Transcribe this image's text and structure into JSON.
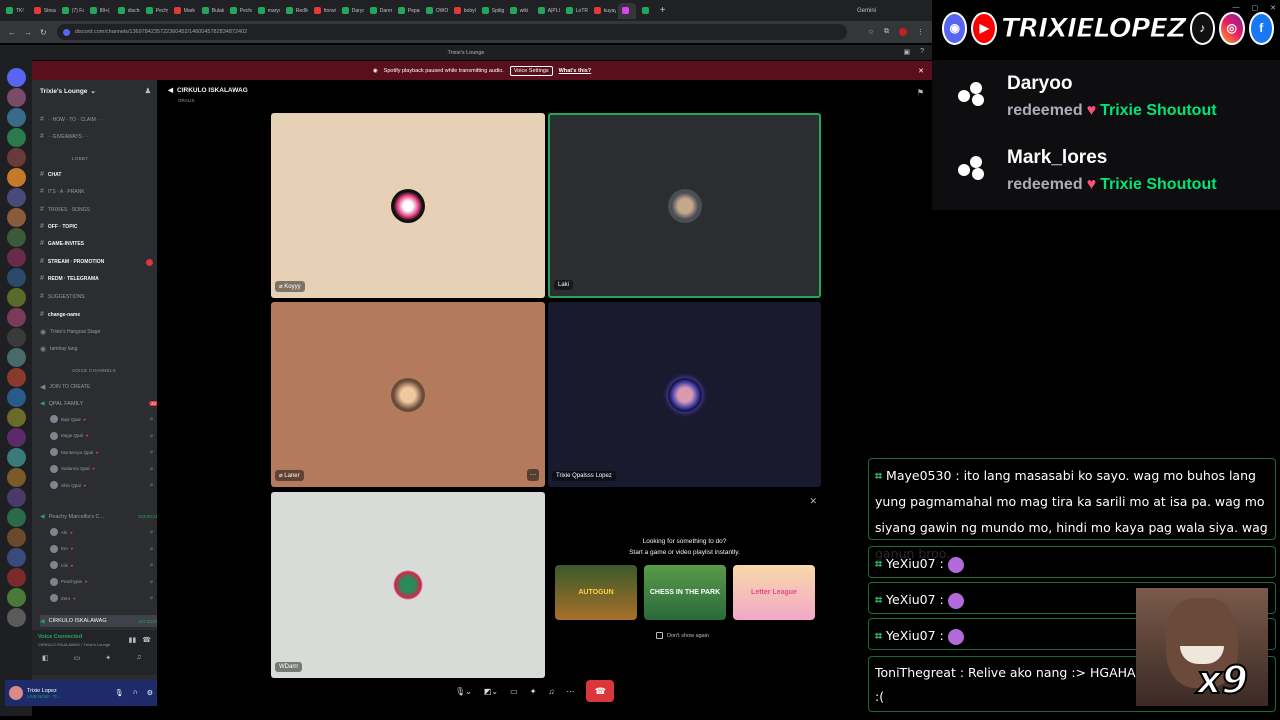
{
  "browser": {
    "tabs": [
      "TK!",
      "Strea",
      "(7) Fa",
      "89+|",
      "discho",
      "Pechy",
      "Mark",
      "Bulak",
      "Pecha",
      "marys",
      "RedM",
      "Itorwi",
      "Daryo",
      "Daren",
      "Pepan",
      "OWO",
      "bobyl",
      "Spitig",
      "wiki",
      "A|PLI",
      "LoTR",
      "kuyay",
      "",
      ""
    ],
    "gemini_label": "Gemini",
    "url": "discord.com/channels/1369784235722360452/1460045782834872402"
  },
  "discord": {
    "window_title": "Trixie's Lounge",
    "notice": {
      "text": "Spotify playback paused while transmitting audio.",
      "button": "Voice Settings",
      "link": "What's this?"
    },
    "server_name": "Trixie's Lounge",
    "channels": [
      {
        "name": "· ·HOW · TO · CLAIM · ·",
        "type": "text"
      },
      {
        "name": "· ·GIVEAWAYS · ·",
        "type": "text"
      },
      {
        "name": "LOBBY",
        "type": "category"
      },
      {
        "name": "CHAT",
        "type": "text"
      },
      {
        "name": "ITS · A · PRANK",
        "type": "text"
      },
      {
        "name": "TRIXIES · SONGS",
        "type": "text"
      },
      {
        "name": "OFF · TOPIC",
        "type": "text"
      },
      {
        "name": "GAME-INVITES",
        "type": "text"
      },
      {
        "name": "STREAM · PROMOTION",
        "type": "text"
      },
      {
        "name": "REDM · TELEGRAMA",
        "type": "text"
      },
      {
        "name": "SUGGESTIONS",
        "type": "text"
      },
      {
        "name": "change-name",
        "type": "text"
      },
      {
        "name": "Trixie's Hangout Stage",
        "type": "stage"
      },
      {
        "name": "tambay lang",
        "type": "stage"
      },
      {
        "name": "VOICE CHANNELS",
        "type": "category"
      },
      {
        "name": "JOIN TO CREATE",
        "type": "voice"
      }
    ],
    "voice_channels": [
      {
        "name": "QPAL FAMILY",
        "count": "22",
        "users": [
          "Bajs Qpal",
          "Mage Qpal",
          "Monteroyo Qpal",
          "Satianna Qpal",
          "Shin Qpal"
        ]
      },
      {
        "name": "Peachy Marcellis's C...",
        "time": "203:09:21",
        "users": [
          "Aki",
          "Em",
          "Icik",
          "Peachypie",
          "Zero"
        ]
      },
      {
        "name": "CIRKULO ISKALAWAG",
        "time": "127:23:06"
      }
    ],
    "voice_status": "Voice Connected",
    "voice_sub": "CIRKULO ISKALAWAG / Trixie's Lounge",
    "user": {
      "name": "Trixie Lopez",
      "status": "LIVE NOW · Tr..."
    },
    "call": {
      "channel": "CIRKULO ISKALAWAG",
      "sub": "ORALIS",
      "tiles": [
        "Koyyy",
        "Laki",
        "Laner",
        "Trixie Qpalsss Lopez",
        "WDarrr"
      ]
    },
    "activity": {
      "line1": "Looking for something to do?",
      "line2": "Start a game or video playlist instantly.",
      "games": [
        "AUTOGUN",
        "CHESS IN THE PARK",
        "Letter League"
      ],
      "dont_show": "Don't show again"
    }
  },
  "overlay": {
    "brand": "TRIXIELOPEZ",
    "redemptions": [
      {
        "user": "Daryoo",
        "action": "redeemed",
        "reward": "Trixie Shoutout"
      },
      {
        "user": "Mark_lores",
        "action": "redeemed",
        "reward": "Trixie Shoutout"
      }
    ],
    "chat": [
      {
        "user": "Maye0530",
        "text": "ito lang masasabi ko sayo. wag mo buhos lang yung pagmamahal mo mag tira ka sarili mo at isa pa. wag mo siyang gawin ng mundo mo, hindi mo kaya pag wala siya. wag ganun broo.."
      },
      {
        "user": "YeXiu07",
        "text": ""
      },
      {
        "user": "YeXiu07",
        "text": ""
      },
      {
        "user": "YeXiu07",
        "text": ""
      },
      {
        "user": "ToniThegreat",
        "text": "Relive ako nang :> HGAHAHAHAHA n hours live :("
      }
    ],
    "meme_count": "x9"
  }
}
